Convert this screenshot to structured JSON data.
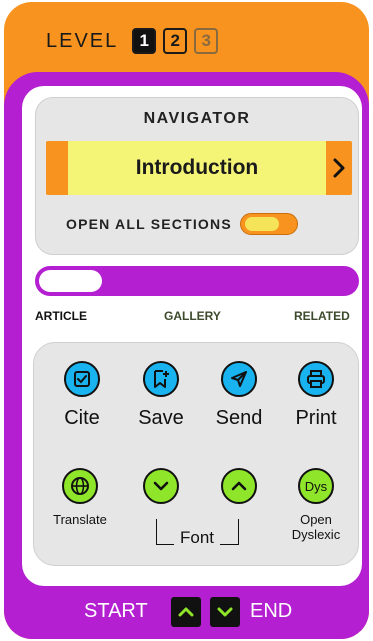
{
  "level": {
    "label": "LEVEL",
    "options": [
      "1",
      "2",
      "3"
    ],
    "selected": "1"
  },
  "navigator": {
    "title": "NAVIGATOR",
    "current_section": "Introduction",
    "open_all_label": "OPEN ALL SECTIONS",
    "open_all_enabled": false
  },
  "progress": {
    "fraction": 0.2
  },
  "tabs": {
    "article": "ARTICLE",
    "gallery": "GALLERY",
    "related": "RELATED",
    "active": "ARTICLE"
  },
  "tools": {
    "cite": "Cite",
    "save": "Save",
    "send": "Send",
    "print": "Print",
    "translate": "Translate",
    "font": "Font",
    "dyslexic_icon_text": "Dys",
    "open_dyslexic_line1": "Open",
    "open_dyslexic_line2": "Dyslexic"
  },
  "icons": {
    "cite": "checkbox-icon",
    "save": "bookmark-plus-icon",
    "send": "paper-plane-icon",
    "print": "printer-icon",
    "translate": "globe-icon",
    "font_down": "chevron-down-icon",
    "font_up": "chevron-up-icon",
    "nav_next": "chevron-right-icon"
  },
  "footer": {
    "start": "START",
    "end": "END"
  },
  "colors": {
    "orange": "#f7931e",
    "purple": "#b41fd1",
    "yellow": "#f4f476",
    "blue": "#19b4ef",
    "green": "#8ee52a"
  }
}
